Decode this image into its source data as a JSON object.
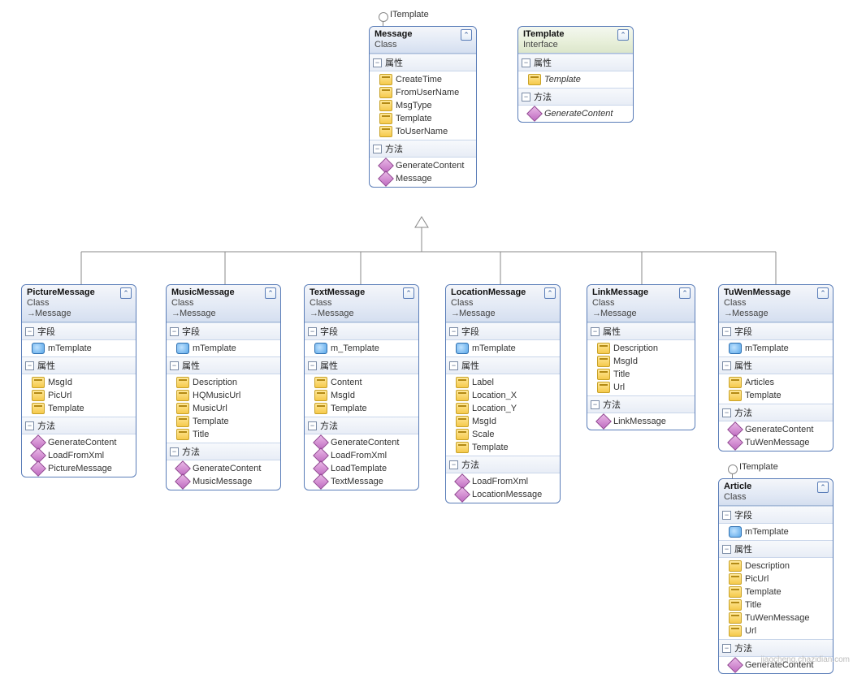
{
  "interface_label": "ITemplate",
  "section_labels": {
    "fields": "字段",
    "properties": "属性",
    "methods": "方法"
  },
  "boxes": {
    "message": {
      "name": "Message",
      "kind": "Class",
      "inherits": null,
      "properties": [
        "CreateTime",
        "FromUserName",
        "MsgType",
        "Template",
        "ToUserName"
      ],
      "methods": [
        "GenerateContent",
        "Message"
      ]
    },
    "itemplate": {
      "name": "ITemplate",
      "kind": "Interface",
      "properties_italic": [
        "Template"
      ],
      "methods_italic": [
        "GenerateContent"
      ]
    },
    "picture": {
      "name": "PictureMessage",
      "kind": "Class",
      "inherits": "Message",
      "fields": [
        "mTemplate"
      ],
      "properties": [
        "MsgId",
        "PicUrl",
        "Template"
      ],
      "methods": [
        "GenerateContent",
        "LoadFromXml",
        "PictureMessage"
      ]
    },
    "music": {
      "name": "MusicMessage",
      "kind": "Class",
      "inherits": "Message",
      "fields": [
        "mTemplate"
      ],
      "properties": [
        "Description",
        "HQMusicUrl",
        "MusicUrl",
        "Template",
        "Title"
      ],
      "methods": [
        "GenerateContent",
        "MusicMessage"
      ]
    },
    "text": {
      "name": "TextMessage",
      "kind": "Class",
      "inherits": "Message",
      "fields": [
        "m_Template"
      ],
      "properties": [
        "Content",
        "MsgId",
        "Template"
      ],
      "methods": [
        "GenerateContent",
        "LoadFromXml",
        "LoadTemplate",
        "TextMessage"
      ]
    },
    "location": {
      "name": "LocationMessage",
      "kind": "Class",
      "inherits": "Message",
      "fields": [
        "mTemplate"
      ],
      "properties": [
        "Label",
        "Location_X",
        "Location_Y",
        "MsgId",
        "Scale",
        "Template"
      ],
      "methods": [
        "LoadFromXml",
        "LocationMessage"
      ]
    },
    "link": {
      "name": "LinkMessage",
      "kind": "Class",
      "inherits": "Message",
      "properties": [
        "Description",
        "MsgId",
        "Title",
        "Url"
      ],
      "methods": [
        "LinkMessage"
      ]
    },
    "tuwen": {
      "name": "TuWenMessage",
      "kind": "Class",
      "inherits": "Message",
      "fields": [
        "mTemplate"
      ],
      "properties": [
        "Articles",
        "Template"
      ],
      "methods": [
        "GenerateContent",
        "TuWenMessage"
      ]
    },
    "article": {
      "name": "Article",
      "kind": "Class",
      "fields": [
        "mTemplate"
      ],
      "properties": [
        "Description",
        "PicUrl",
        "Template",
        "Title",
        "TuWenMessage",
        "Url"
      ],
      "methods": [
        "GenerateContent"
      ]
    }
  },
  "watermark": "jiaocheng.chazidian.com"
}
